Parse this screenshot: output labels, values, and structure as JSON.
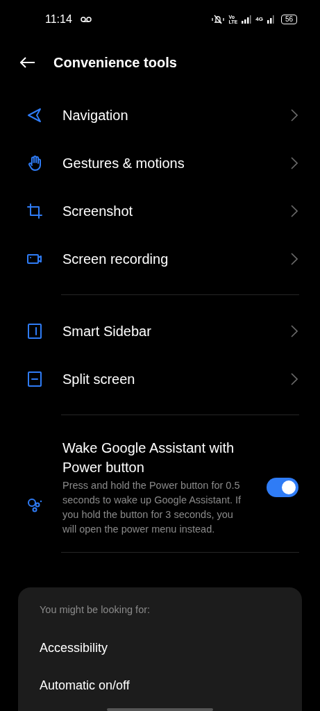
{
  "status_bar": {
    "time": "11:14",
    "volte_top": "Vo",
    "volte_bottom": "LTE",
    "network": "4G",
    "battery": "56"
  },
  "header": {
    "title": "Convenience tools"
  },
  "groups": [
    {
      "items": [
        {
          "kind": "link",
          "label": "Navigation"
        },
        {
          "kind": "link",
          "label": "Gestures & motions"
        },
        {
          "kind": "link",
          "label": "Screenshot"
        },
        {
          "kind": "link",
          "label": "Screen recording"
        }
      ]
    },
    {
      "items": [
        {
          "kind": "link",
          "label": "Smart Sidebar"
        },
        {
          "kind": "link",
          "label": "Split screen"
        }
      ]
    },
    {
      "items": [
        {
          "kind": "toggle",
          "label": "Wake Google Assistant with Power button",
          "description": "Press and hold the Power button for 0.5 seconds to wake up Google Assistant. If you hold the button for 3 seconds, you will open the power menu instead.",
          "on": true
        }
      ]
    }
  ],
  "suggestions": {
    "heading": "You might be looking for:",
    "items": [
      "Accessibility",
      "Automatic on/off"
    ]
  }
}
